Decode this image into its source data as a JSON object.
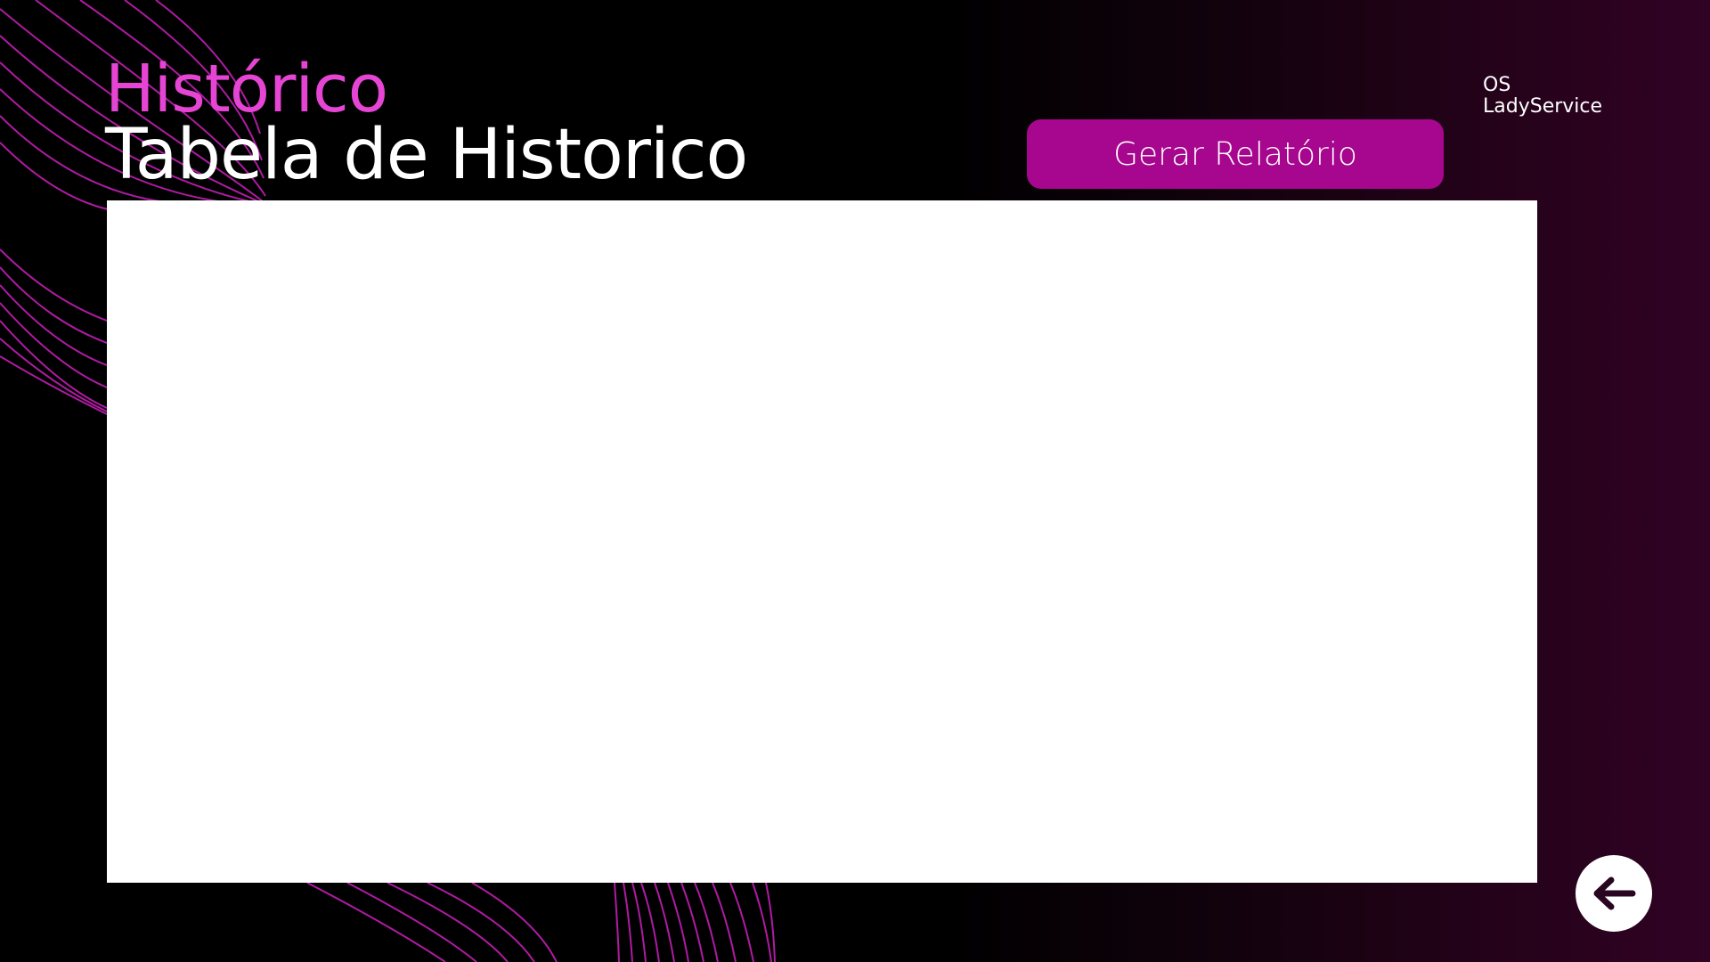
{
  "header": {
    "title_accent": "Histórico",
    "title_main": "Tabela de Historico"
  },
  "brand": {
    "line1": "OS",
    "line2": "LadyService"
  },
  "actions": {
    "report_label": "Gerar Relatório"
  },
  "icons": {
    "back": "arrow-left-icon"
  },
  "colors": {
    "accent_text": "#e645d4",
    "button_bg": "#a7078e",
    "decor_lines": "#c21fb4",
    "background_dark": "#000000",
    "background_light": "#300224"
  }
}
